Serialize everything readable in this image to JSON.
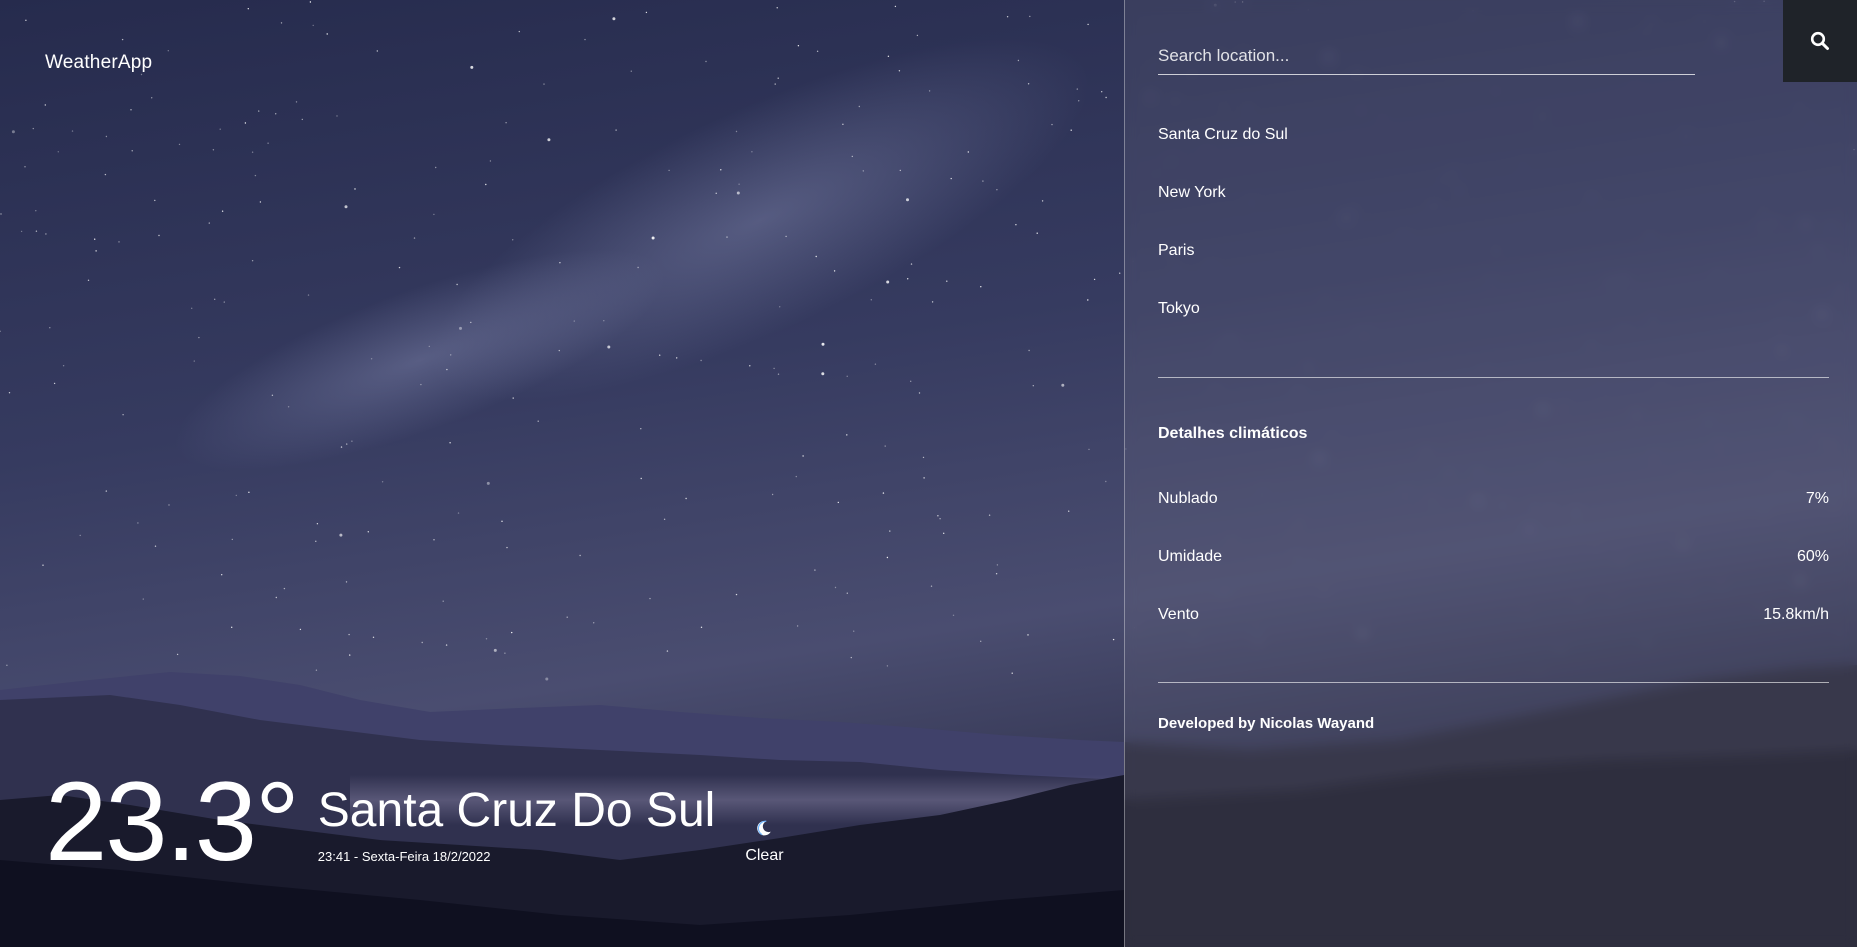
{
  "app": {
    "brand": "WeatherApp"
  },
  "current": {
    "temperature": "23.3°",
    "city": "Santa Cruz Do Sul",
    "datetime": "23:41 - Sexta-Feira 18/2/2022",
    "condition": "Clear",
    "condition_icon": "moon-icon"
  },
  "search": {
    "placeholder": "Search location...",
    "value": "",
    "button_icon": "search-icon"
  },
  "locations": [
    "Santa Cruz do Sul",
    "New York",
    "Paris",
    "Tokyo"
  ],
  "details": {
    "title": "Detalhes climáticos",
    "items": [
      {
        "label": "Nublado",
        "value": "7%"
      },
      {
        "label": "Umidade",
        "value": "60%"
      },
      {
        "label": "Vento",
        "value": "15.8km/h"
      }
    ]
  },
  "footer": {
    "credit": "Developed by Nicolas Wayand"
  },
  "colors": {
    "sky_top": "#2a2f52",
    "sky_mid": "#3a3f63",
    "mountain_dark": "#15172a",
    "search_button_bg": "#1f2329",
    "text": "#ffffff"
  }
}
